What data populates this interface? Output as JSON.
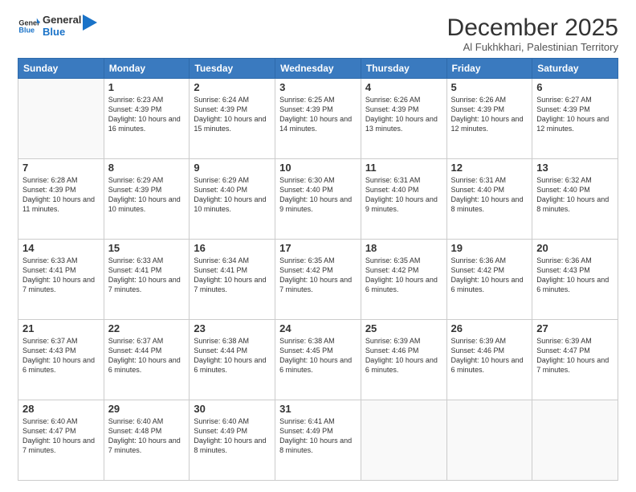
{
  "logo": {
    "text_general": "General",
    "text_blue": "Blue"
  },
  "header": {
    "title": "December 2025",
    "subtitle": "Al Fukhkhari, Palestinian Territory"
  },
  "weekdays": [
    "Sunday",
    "Monday",
    "Tuesday",
    "Wednesday",
    "Thursday",
    "Friday",
    "Saturday"
  ],
  "weeks": [
    [
      {
        "day": "",
        "info": ""
      },
      {
        "day": "1",
        "info": "Sunrise: 6:23 AM\nSunset: 4:39 PM\nDaylight: 10 hours and 16 minutes."
      },
      {
        "day": "2",
        "info": "Sunrise: 6:24 AM\nSunset: 4:39 PM\nDaylight: 10 hours and 15 minutes."
      },
      {
        "day": "3",
        "info": "Sunrise: 6:25 AM\nSunset: 4:39 PM\nDaylight: 10 hours and 14 minutes."
      },
      {
        "day": "4",
        "info": "Sunrise: 6:26 AM\nSunset: 4:39 PM\nDaylight: 10 hours and 13 minutes."
      },
      {
        "day": "5",
        "info": "Sunrise: 6:26 AM\nSunset: 4:39 PM\nDaylight: 10 hours and 12 minutes."
      },
      {
        "day": "6",
        "info": "Sunrise: 6:27 AM\nSunset: 4:39 PM\nDaylight: 10 hours and 12 minutes."
      }
    ],
    [
      {
        "day": "7",
        "info": "Sunrise: 6:28 AM\nSunset: 4:39 PM\nDaylight: 10 hours and 11 minutes."
      },
      {
        "day": "8",
        "info": "Sunrise: 6:29 AM\nSunset: 4:39 PM\nDaylight: 10 hours and 10 minutes."
      },
      {
        "day": "9",
        "info": "Sunrise: 6:29 AM\nSunset: 4:40 PM\nDaylight: 10 hours and 10 minutes."
      },
      {
        "day": "10",
        "info": "Sunrise: 6:30 AM\nSunset: 4:40 PM\nDaylight: 10 hours and 9 minutes."
      },
      {
        "day": "11",
        "info": "Sunrise: 6:31 AM\nSunset: 4:40 PM\nDaylight: 10 hours and 9 minutes."
      },
      {
        "day": "12",
        "info": "Sunrise: 6:31 AM\nSunset: 4:40 PM\nDaylight: 10 hours and 8 minutes."
      },
      {
        "day": "13",
        "info": "Sunrise: 6:32 AM\nSunset: 4:40 PM\nDaylight: 10 hours and 8 minutes."
      }
    ],
    [
      {
        "day": "14",
        "info": "Sunrise: 6:33 AM\nSunset: 4:41 PM\nDaylight: 10 hours and 7 minutes."
      },
      {
        "day": "15",
        "info": "Sunrise: 6:33 AM\nSunset: 4:41 PM\nDaylight: 10 hours and 7 minutes."
      },
      {
        "day": "16",
        "info": "Sunrise: 6:34 AM\nSunset: 4:41 PM\nDaylight: 10 hours and 7 minutes."
      },
      {
        "day": "17",
        "info": "Sunrise: 6:35 AM\nSunset: 4:42 PM\nDaylight: 10 hours and 7 minutes."
      },
      {
        "day": "18",
        "info": "Sunrise: 6:35 AM\nSunset: 4:42 PM\nDaylight: 10 hours and 6 minutes."
      },
      {
        "day": "19",
        "info": "Sunrise: 6:36 AM\nSunset: 4:42 PM\nDaylight: 10 hours and 6 minutes."
      },
      {
        "day": "20",
        "info": "Sunrise: 6:36 AM\nSunset: 4:43 PM\nDaylight: 10 hours and 6 minutes."
      }
    ],
    [
      {
        "day": "21",
        "info": "Sunrise: 6:37 AM\nSunset: 4:43 PM\nDaylight: 10 hours and 6 minutes."
      },
      {
        "day": "22",
        "info": "Sunrise: 6:37 AM\nSunset: 4:44 PM\nDaylight: 10 hours and 6 minutes."
      },
      {
        "day": "23",
        "info": "Sunrise: 6:38 AM\nSunset: 4:44 PM\nDaylight: 10 hours and 6 minutes."
      },
      {
        "day": "24",
        "info": "Sunrise: 6:38 AM\nSunset: 4:45 PM\nDaylight: 10 hours and 6 minutes."
      },
      {
        "day": "25",
        "info": "Sunrise: 6:39 AM\nSunset: 4:46 PM\nDaylight: 10 hours and 6 minutes."
      },
      {
        "day": "26",
        "info": "Sunrise: 6:39 AM\nSunset: 4:46 PM\nDaylight: 10 hours and 6 minutes."
      },
      {
        "day": "27",
        "info": "Sunrise: 6:39 AM\nSunset: 4:47 PM\nDaylight: 10 hours and 7 minutes."
      }
    ],
    [
      {
        "day": "28",
        "info": "Sunrise: 6:40 AM\nSunset: 4:47 PM\nDaylight: 10 hours and 7 minutes."
      },
      {
        "day": "29",
        "info": "Sunrise: 6:40 AM\nSunset: 4:48 PM\nDaylight: 10 hours and 7 minutes."
      },
      {
        "day": "30",
        "info": "Sunrise: 6:40 AM\nSunset: 4:49 PM\nDaylight: 10 hours and 8 minutes."
      },
      {
        "day": "31",
        "info": "Sunrise: 6:41 AM\nSunset: 4:49 PM\nDaylight: 10 hours and 8 minutes."
      },
      {
        "day": "",
        "info": ""
      },
      {
        "day": "",
        "info": ""
      },
      {
        "day": "",
        "info": ""
      }
    ]
  ]
}
